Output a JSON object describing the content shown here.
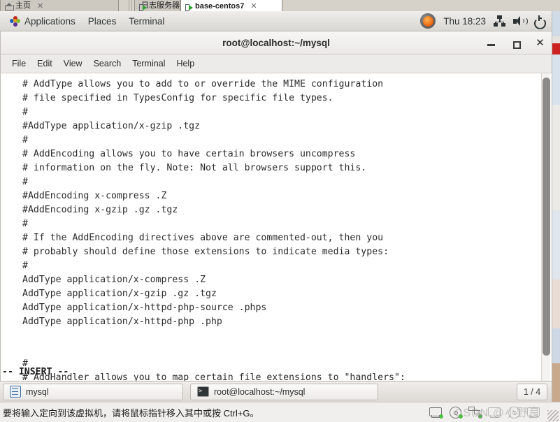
{
  "vmware": {
    "tabs": [
      {
        "label": "主页",
        "icon": "home-icon",
        "active": false
      },
      {
        "label": "日志服务器",
        "icon": "vm-play-icon",
        "active": false
      },
      {
        "label": "base-centos7",
        "icon": "vm-play-icon",
        "active": true
      }
    ],
    "close_glyph": "✕",
    "status_message": "要将输入定向到该虚拟机，请将鼠标指针移入其中或按 Ctrl+G。",
    "status_icons": [
      "disk-icon",
      "cdrom-icon",
      "network-icon",
      "usb-icon",
      "sound-icon",
      "printer-icon"
    ],
    "watermark": "CSDN @小野良"
  },
  "gnome_panel": {
    "menus": [
      "Applications",
      "Places",
      "Terminal"
    ],
    "logo": "gnome-foot-icon",
    "clock": "Thu 18:23",
    "tray": [
      "firefox-icon",
      "network-icon",
      "volume-icon",
      "power-icon"
    ]
  },
  "terminal": {
    "title": "root@localhost:~/mysql",
    "window_buttons": {
      "minimize": "minimize-icon",
      "maximize": "maximize-icon",
      "close": "✕"
    },
    "menu": [
      "File",
      "Edit",
      "View",
      "Search",
      "Terminal",
      "Help"
    ],
    "content": "# AddType allows you to add to or override the MIME configuration\n# file specified in TypesConfig for specific file types.\n#\n#AddType application/x-gzip .tgz\n#\n# AddEncoding allows you to have certain browsers uncompress\n# information on the fly. Note: Not all browsers support this.\n#\n#AddEncoding x-compress .Z\n#AddEncoding x-gzip .gz .tgz\n#\n# If the AddEncoding directives above are commented-out, then you\n# probably should define those extensions to indicate media types:\n#\nAddType application/x-compress .Z\nAddType application/x-gzip .gz .tgz\nAddType application/x-httpd-php-source .phps\nAddType application/x-httpd-php .php\n\n\n#\n# AddHandler allows you to map certain file extensions to \"handlers\":\n# actions unrelated to filetype. These can be either built into the server",
    "status_line": "-- INSERT --"
  },
  "taskbar": {
    "items": [
      {
        "label": "mysql",
        "icon": "file-manager-icon"
      },
      {
        "label": "root@localhost:~/mysql",
        "icon": "terminal-icon"
      }
    ],
    "workspace_counter": "1 / 4"
  }
}
